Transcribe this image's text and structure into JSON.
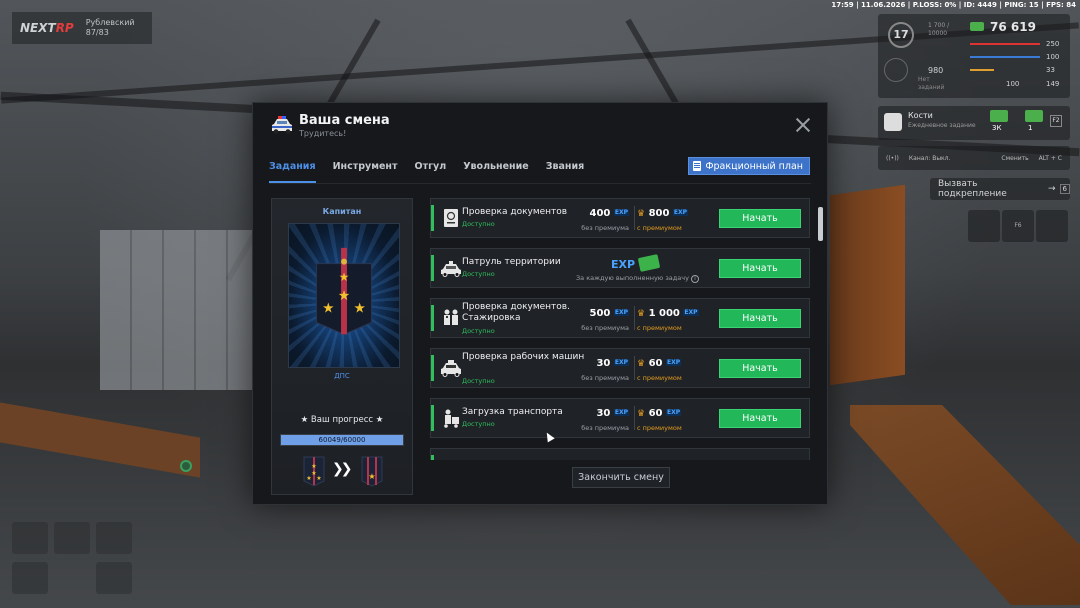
{
  "hud": {
    "status_bar": "17:59 | 11.06.2026 | P.LOSS: 0% | ID: 4449 | PING: 15 | FPS: 84",
    "logo_left": "NEXT",
    "logo_right": "RP",
    "server_name": "Рублевский",
    "server_sub": "87/83",
    "level": "17",
    "level_progress_a": "1 700 /",
    "level_progress_b": "10000",
    "money": "76 619",
    "xp": "980",
    "health": "250",
    "armor": "100",
    "hunger": "33",
    "stat_a": "100",
    "stat_b": "149",
    "no_tasks_a": "Нет",
    "no_tasks_b": "заданий",
    "kosti_title": "Кости",
    "kosti_sub": "Ежедневное задание",
    "kosti_reward1": "3К",
    "kosti_reward2": "1",
    "kosti_key": "F2",
    "channel_label": "Канал: Выкл.",
    "channel_change": "Сменить",
    "channel_keys": "ALT + C",
    "backup_label": "Вызвать подкрепление",
    "backup_key": "6",
    "slot_key": "F6"
  },
  "modal": {
    "title": "Ваша смена",
    "subtitle": "Трудитесь!",
    "tabs": [
      "Задания",
      "Инструмент",
      "Отгул",
      "Увольнение",
      "Звания"
    ],
    "active_tab": 0,
    "plan_button": "Фракционный план",
    "finish_button": "Закончить смену"
  },
  "rank": {
    "name": "Капитан",
    "department": "ДПС",
    "progress_label": "★ Ваш прогресс ★",
    "progress_text": "60049/60000",
    "progress_fraction": 1.0
  },
  "tasks": [
    {
      "name": "Проверка документов",
      "status": "Доступно",
      "reward_base": "400",
      "reward_base_caption": "без премиума",
      "reward_premium": "800",
      "reward_premium_caption": "с премиумом",
      "start": "Начать",
      "icon": "passport-icon"
    },
    {
      "name": "Патруль территории",
      "status": "Доступно",
      "patrol_caption": "За каждую выполненную задачу",
      "start": "Начать",
      "icon": "police-car-icon"
    },
    {
      "name": "Проверка документов. Стажировка",
      "status": "Доступно",
      "reward_base": "500",
      "reward_base_caption": "без премиума",
      "reward_premium": "1 000",
      "reward_premium_caption": "с премиумом",
      "start": "Начать",
      "icon": "officers-icon"
    },
    {
      "name": "Проверка рабочих машин",
      "status": "Доступно",
      "reward_base": "30",
      "reward_base_caption": "без премиума",
      "reward_premium": "60",
      "reward_premium_caption": "с премиумом",
      "start": "Начать",
      "icon": "taxi-icon"
    },
    {
      "name": "Загрузка транспорта",
      "status": "Доступно",
      "reward_base": "30",
      "reward_base_caption": "без премиума",
      "reward_premium": "60",
      "reward_premium_caption": "с премиумом",
      "start": "Начать",
      "icon": "loader-icon"
    }
  ],
  "labels": {
    "exp": "EXP",
    "crown": "♛"
  },
  "colors": {
    "accent_blue": "#4e8fe6",
    "start_green": "#22b85a",
    "premium_gold": "#e39b1e",
    "available_green": "#2fbf5b"
  }
}
